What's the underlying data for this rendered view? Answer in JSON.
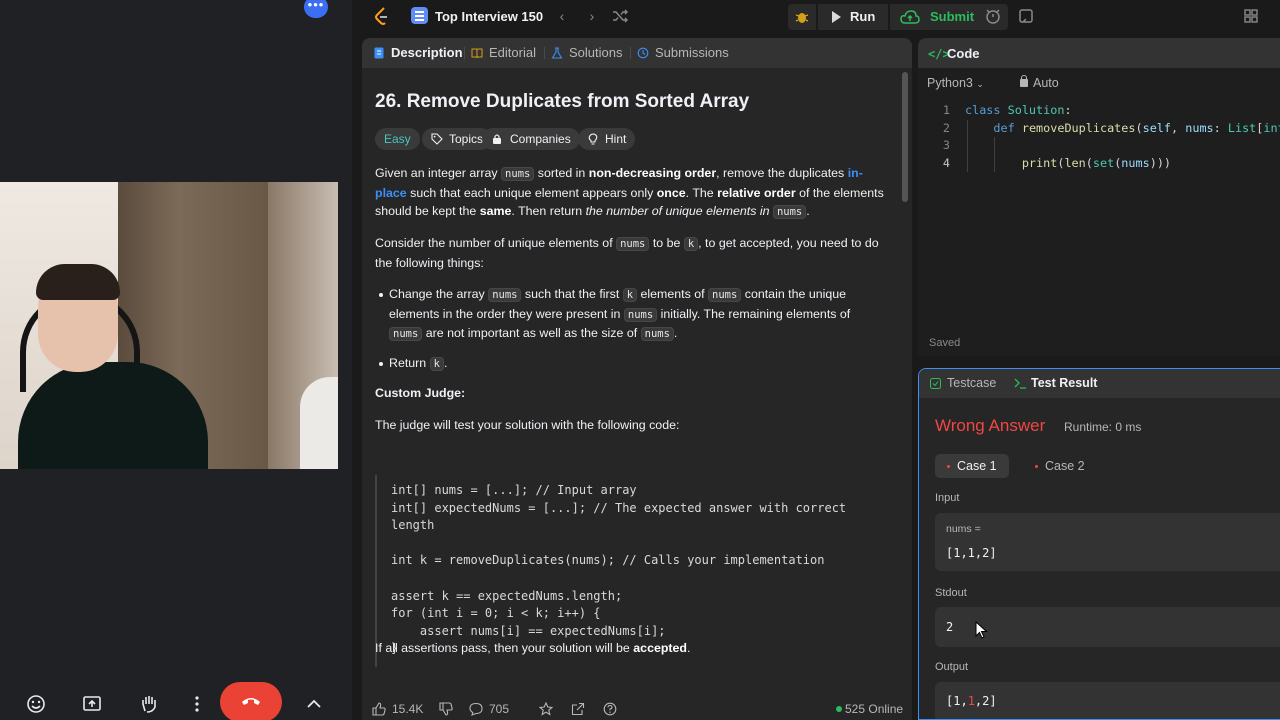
{
  "call": {
    "controls": [
      "emoji-icon",
      "present-icon",
      "raise-hand-icon",
      "more-options-icon",
      "end-call-icon",
      "chevron-up-icon"
    ]
  },
  "nav": {
    "title": "Top Interview 150",
    "run_label": "Run",
    "submit_label": "Submit"
  },
  "description": {
    "tabs": [
      "Description",
      "Editorial",
      "Solutions",
      "Submissions"
    ],
    "title": "26. Remove Duplicates from Sorted Array",
    "chips": [
      "Easy",
      "Topics",
      "Companies",
      "Hint"
    ],
    "custom_judge_heading": "Custom Judge:",
    "judge_intro": "The judge will test your solution with the following code:",
    "judge_code": [
      "int[] nums = [...]; // Input array",
      "int[] expectedNums = [...]; // The expected answer with correct",
      "length",
      "",
      "int k = removeDuplicates(nums); // Calls your implementation",
      "",
      "assert k == expectedNums.length;",
      "for (int i = 0; i < k; i++) {",
      "    assert nums[i] == expectedNums[i];",
      "}"
    ],
    "footer": {
      "likes": "15.4K",
      "comments": "705",
      "online": "525 Online"
    }
  },
  "code": {
    "title": "Code",
    "language": "Python3",
    "mode": "Auto",
    "status": "Saved",
    "line_numbers": [
      "1",
      "2",
      "3",
      "4"
    ]
  },
  "result": {
    "tabs": [
      "Testcase",
      "Test Result"
    ],
    "verdict": "Wrong Answer",
    "runtime": "Runtime: 0 ms",
    "cases": [
      "Case 1",
      "Case 2"
    ],
    "input_label": "Input",
    "input_var": "nums =",
    "input_value": "[1,1,2]",
    "stdout_label": "Stdout",
    "stdout_value": "2",
    "output_label": "Output",
    "colors": {
      "wrong": "#ef4743",
      "accept": "#2cbb5d",
      "link": "#3b8ff6"
    }
  }
}
